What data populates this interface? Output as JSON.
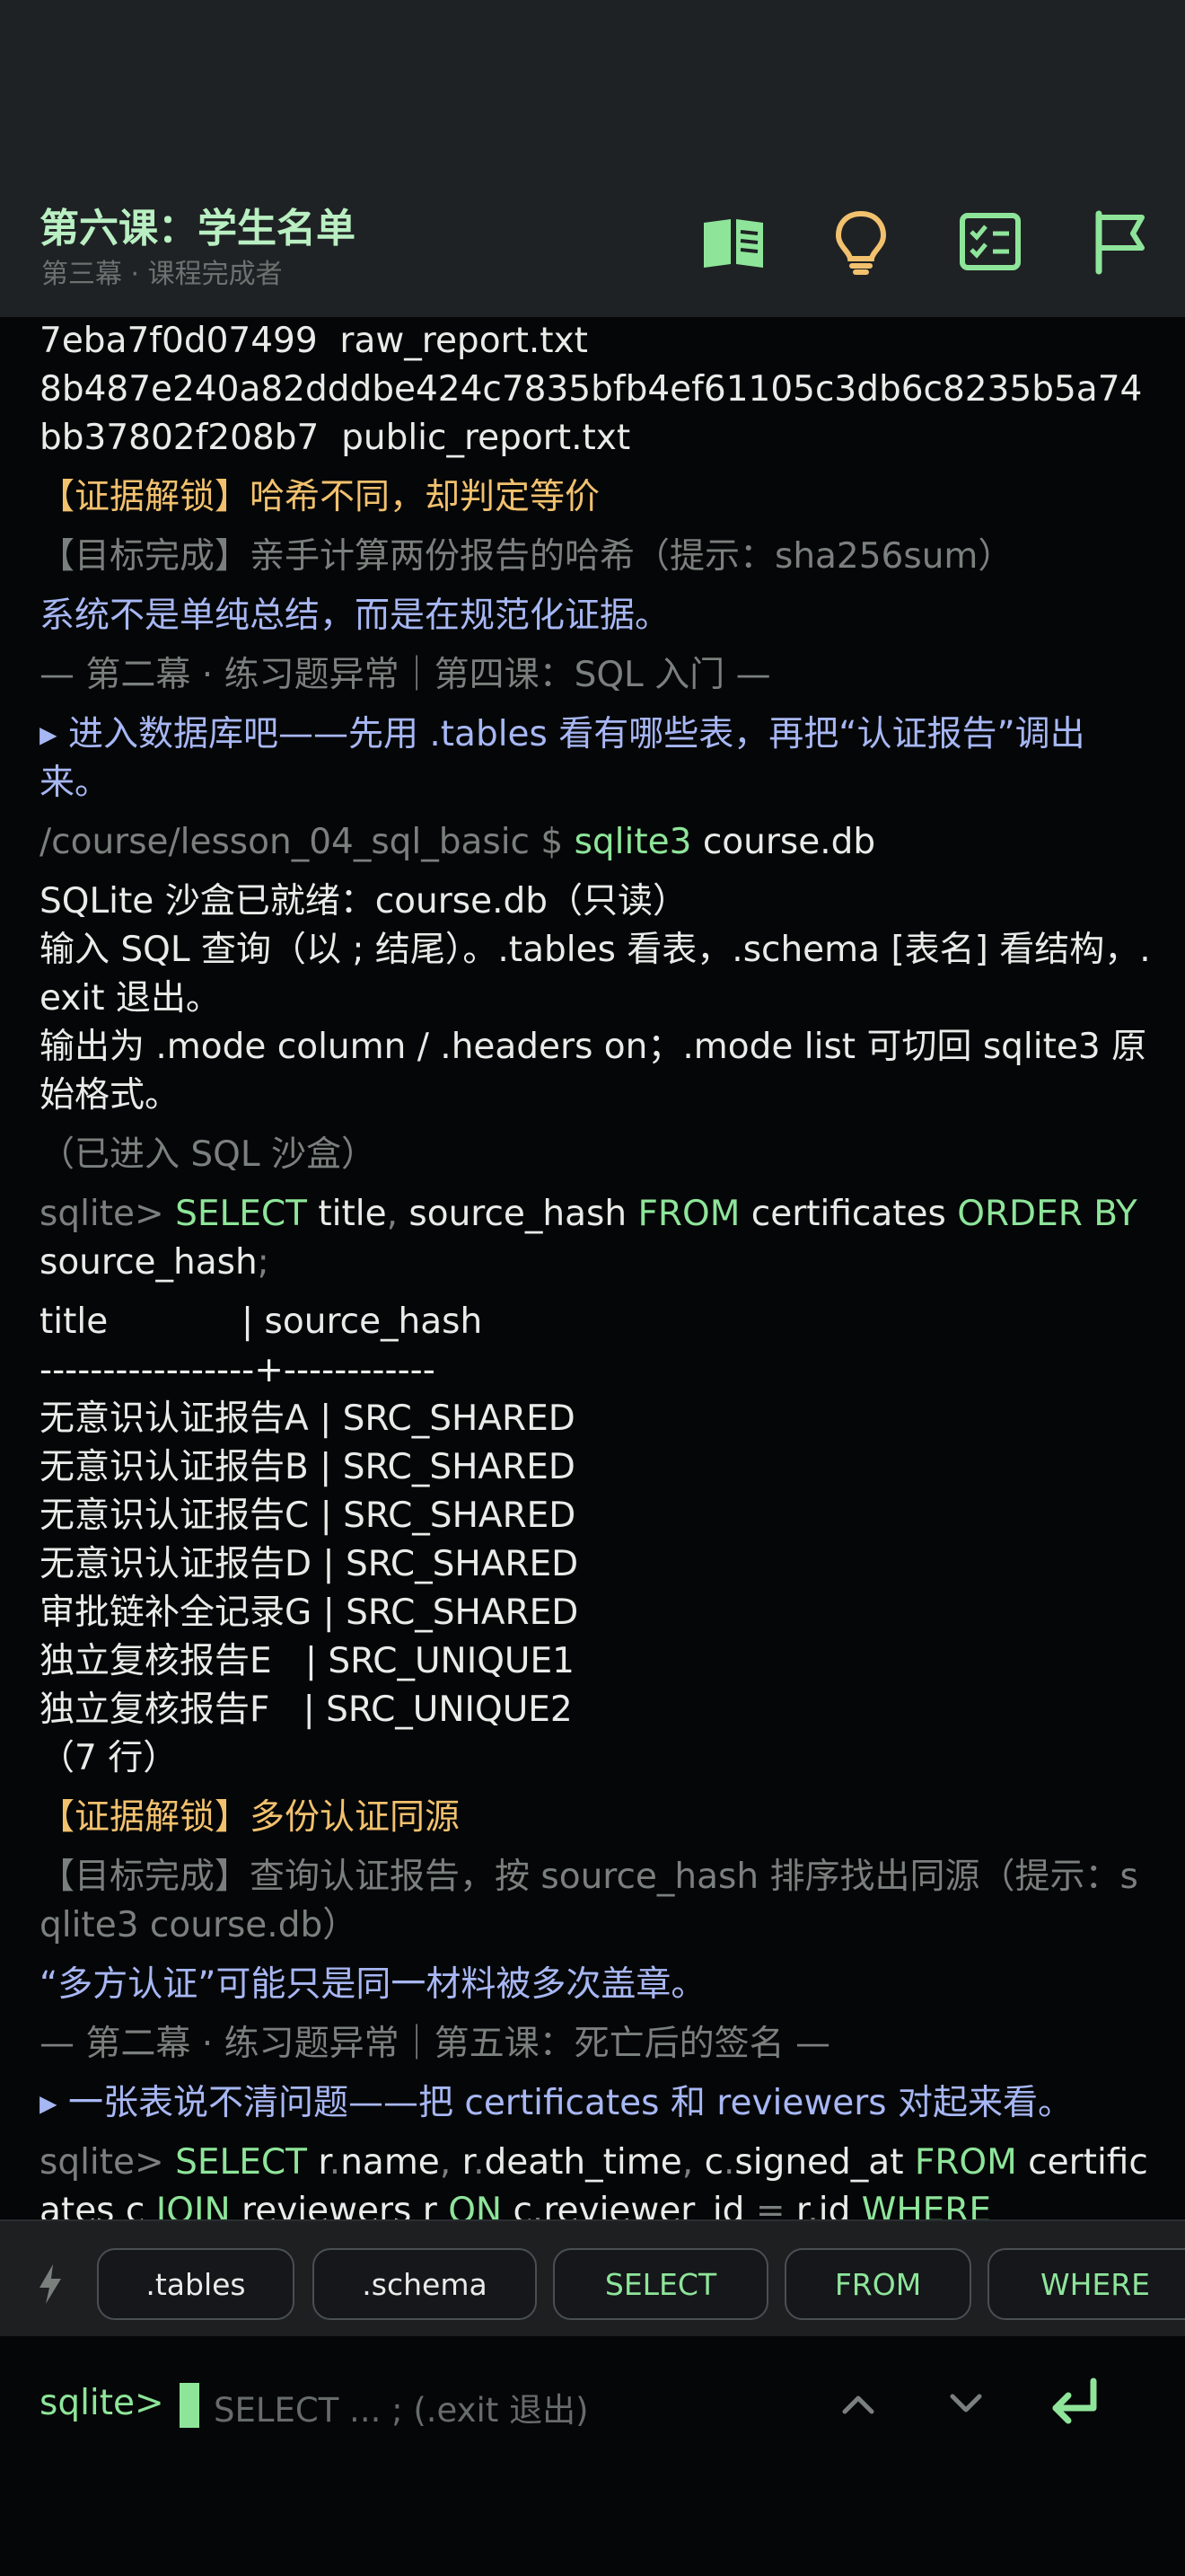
{
  "header": {
    "title": "第六课：学生名单",
    "subtitle": "第三幕 · 课程完成者"
  },
  "terminal_lines": [
    {
      "cls": "white",
      "text": "7eba7f0d07499  raw_report.txt"
    },
    {
      "cls": "white",
      "text": "8b487e240a82dddbe424c7835bfb4ef61105c3db6c8235b5a74bb37802f208b7  public_report.txt"
    },
    {
      "cls": "gap"
    },
    {
      "cls": "gold",
      "text": "【证据解锁】哈希不同，却判定等价"
    },
    {
      "cls": "gap"
    },
    {
      "cls": "muted",
      "text": "【目标完成】亲手计算两份报告的哈希（提示：sha256sum）"
    },
    {
      "cls": "gap"
    },
    {
      "cls": "blue",
      "text": "系统不是单纯总结，而是在规范化证据。"
    },
    {
      "cls": "gap"
    },
    {
      "cls": "muted",
      "text": "— 第二幕 · 练习题异常｜第四课：SQL 入门 —"
    },
    {
      "cls": "gap"
    },
    {
      "cls": "blue",
      "text": "▸ 进入数据库吧——先用 .tables 看有哪些表，再把“认证报告”调出来。"
    },
    {
      "cls": "gap"
    },
    {
      "cls": "cmd",
      "prompt": "/course/lesson_04_sql_basic $ ",
      "cmd": "sqlite3",
      "arg": " course.db"
    },
    {
      "cls": "gap"
    },
    {
      "cls": "white",
      "text": "SQLite 沙盒已就绪：course.db（只读）"
    },
    {
      "cls": "white",
      "text": "输入 SQL 查询（以 ; 结尾）。.tables 看表，.schema [表名] 看结构，.exit 退出。"
    },
    {
      "cls": "white",
      "text": "输出为 .mode column / .headers on；.mode list 可切回 sqlite3 原始格式。"
    },
    {
      "cls": "gap"
    },
    {
      "cls": "muted",
      "text": "（已进入 SQL 沙盒）"
    },
    {
      "cls": "gap"
    },
    {
      "cls": "sql",
      "parts": [
        [
          "muted",
          "sqlite> "
        ],
        [
          "green",
          "SELECT"
        ],
        [
          "white",
          " title"
        ],
        [
          "muted",
          ","
        ],
        [
          "white",
          " source_hash "
        ],
        [
          "green",
          "FROM"
        ],
        [
          "white",
          " certificates "
        ],
        [
          "green",
          "ORDER BY"
        ],
        [
          "white",
          " source_hash"
        ],
        [
          "muted",
          ";"
        ]
      ]
    },
    {
      "cls": "gap"
    },
    {
      "cls": "white",
      "text": "title            | source_hash"
    },
    {
      "cls": "white",
      "text": "-----------------+------------"
    },
    {
      "cls": "white",
      "text": "无意识认证报告A | SRC_SHARED"
    },
    {
      "cls": "white",
      "text": "无意识认证报告B | SRC_SHARED"
    },
    {
      "cls": "white",
      "text": "无意识认证报告C | SRC_SHARED"
    },
    {
      "cls": "white",
      "text": "无意识认证报告D | SRC_SHARED"
    },
    {
      "cls": "white",
      "text": "审批链补全记录G | SRC_SHARED"
    },
    {
      "cls": "white",
      "text": "独立复核报告E   | SRC_UNIQUE1"
    },
    {
      "cls": "white",
      "text": "独立复核报告F   | SRC_UNIQUE2"
    },
    {
      "cls": "white",
      "text": "（7 行）"
    },
    {
      "cls": "gap"
    },
    {
      "cls": "gold",
      "text": "【证据解锁】多份认证同源"
    },
    {
      "cls": "gap"
    },
    {
      "cls": "muted",
      "text": "【目标完成】查询认证报告，按 source_hash 排序找出同源（提示：sqlite3 course.db）"
    },
    {
      "cls": "gap"
    },
    {
      "cls": "blue",
      "text": "“多方认证”可能只是同一材料被多次盖章。"
    },
    {
      "cls": "gap"
    },
    {
      "cls": "muted",
      "text": "— 第二幕 · 练习题异常｜第五课：死亡后的签名 —"
    },
    {
      "cls": "gap"
    },
    {
      "cls": "blue",
      "text": "▸ 一张表说不清问题——把 certificates 和 reviewers 对起来看。"
    },
    {
      "cls": "gap"
    },
    {
      "cls": "sql",
      "parts": [
        [
          "muted",
          "sqlite> "
        ],
        [
          "green",
          "SELECT"
        ],
        [
          "white",
          " r"
        ],
        [
          "muted",
          "."
        ],
        [
          "white",
          "name"
        ],
        [
          "muted",
          ","
        ],
        [
          "white",
          " r"
        ],
        [
          "muted",
          "."
        ],
        [
          "white",
          "death_time"
        ],
        [
          "muted",
          ","
        ],
        [
          "white",
          " c"
        ],
        [
          "muted",
          "."
        ],
        [
          "white",
          "signed_at "
        ],
        [
          "green",
          "FROM"
        ],
        [
          "white",
          " certificates c "
        ],
        [
          "green",
          "JOIN"
        ],
        [
          "white",
          " reviewers r "
        ],
        [
          "green",
          "ON"
        ],
        [
          "white",
          " c"
        ],
        [
          "muted",
          "."
        ],
        [
          "white",
          "reviewer_id "
        ],
        [
          "muted",
          "="
        ],
        [
          "white",
          " r"
        ],
        [
          "muted",
          "."
        ],
        [
          "white",
          "id "
        ],
        [
          "green",
          "WHERE"
        ]
      ]
    }
  ],
  "quickbar": {
    "icon": "lightning-icon",
    "chips": [
      ".tables",
      ".schema",
      "SELECT",
      "FROM",
      "WHERE"
    ]
  },
  "input": {
    "prompt": "sqlite>",
    "placeholder": "SELECT ... ;  (.exit 退出)"
  },
  "colors": {
    "accent": "#8ee59a",
    "gold": "#f2c16e",
    "blue": "#a7b7f4",
    "muted": "#7a807d"
  }
}
